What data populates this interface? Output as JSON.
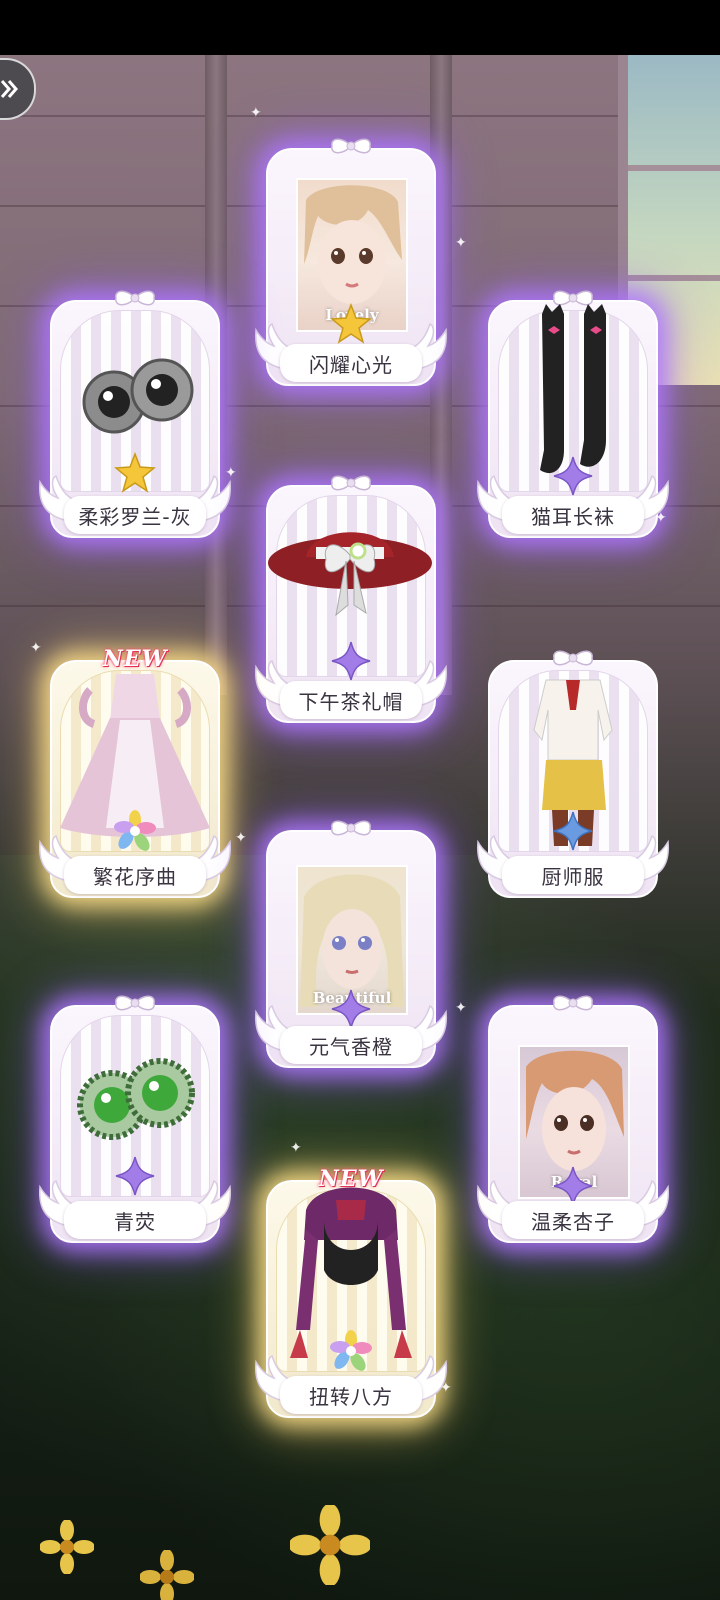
{
  "cards": [
    {
      "name": "闪耀心光",
      "item_icon": "face-portrait-icon",
      "portrait_caption": "Lovely",
      "rarity_color": "#f5c63a",
      "glow": "purple"
    },
    {
      "name": "柔彩罗兰-灰",
      "item_icon": "gray-eyes-icon",
      "rarity_color": "#f5c63a",
      "glow": "purple"
    },
    {
      "name": "猫耳长袜",
      "item_icon": "cat-ear-stockings-icon",
      "rarity_color": "#a27de8",
      "glow": "purple"
    },
    {
      "name": "下午茶礼帽",
      "item_icon": "red-tea-hat-icon",
      "rarity_color": "#a27de8",
      "glow": "purple"
    },
    {
      "name": "繁花序曲",
      "item_icon": "flower-gown-icon",
      "badge": "NEW",
      "rarity_color": "multicolor",
      "glow": "gold"
    },
    {
      "name": "厨师服",
      "item_icon": "chef-outfit-icon",
      "rarity_color": "#6a9be0",
      "glow": "none"
    },
    {
      "name": "元气香橙",
      "item_icon": "face-portrait-icon",
      "portrait_caption": "Beautiful",
      "rarity_color": "#a27de8",
      "glow": "purple"
    },
    {
      "name": "青荧",
      "item_icon": "green-eyes-icon",
      "rarity_color": "#a27de8",
      "glow": "purple"
    },
    {
      "name": "温柔杏子",
      "item_icon": "face-portrait-icon",
      "portrait_caption": "Royal",
      "rarity_color": "#a27de8",
      "glow": "purple"
    },
    {
      "name": "扭转八方",
      "item_icon": "braided-hair-icon",
      "badge": "NEW",
      "rarity_color": "multicolor",
      "glow": "gold"
    }
  ],
  "back_button": {
    "icon": "double-chevron-right-icon"
  }
}
